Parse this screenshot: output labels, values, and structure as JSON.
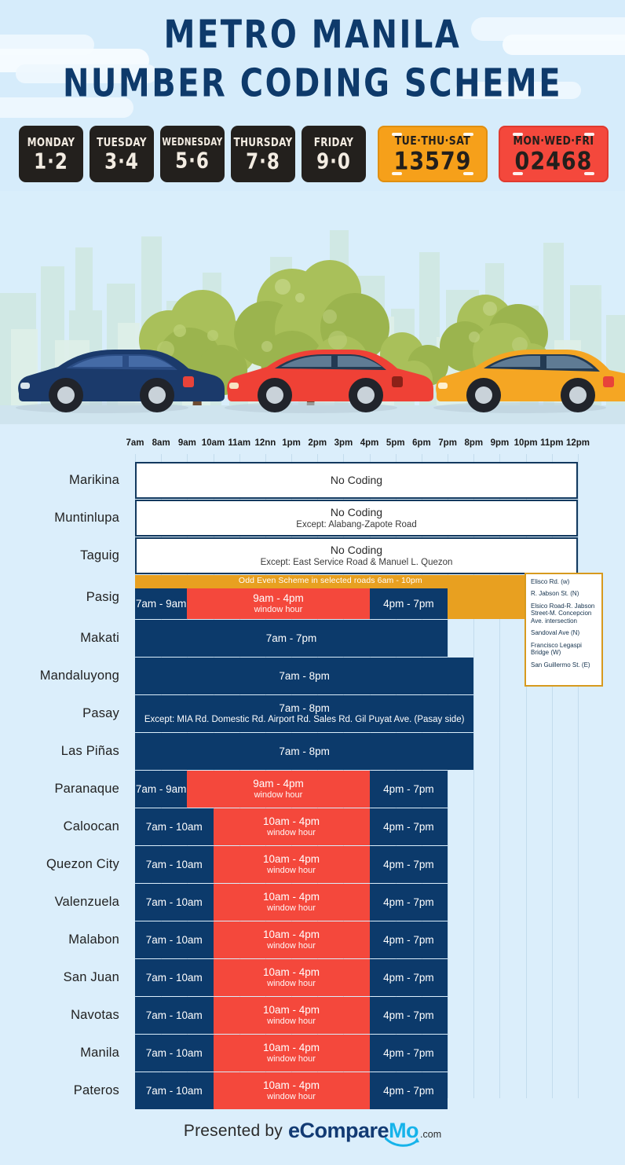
{
  "title": {
    "line1": "METRO MANILA",
    "line2": "NUMBER CODING SCHEME"
  },
  "colors": {
    "background": "#d9eefb",
    "title_navy": "#0e3a6b",
    "bar_navy": "#0c3a6b",
    "bar_red": "#f4483c",
    "odd_even_orange": "#e8a020",
    "plate_odd": "#f6a01a",
    "plate_even": "#f4483c",
    "badge_dark": "#23201d"
  },
  "day_badges": [
    {
      "day": "MONDAY",
      "numbers": "1·2"
    },
    {
      "day": "TUESDAY",
      "numbers": "3·4"
    },
    {
      "day": "WEDNESDAY",
      "numbers": "5·6"
    },
    {
      "day": "THURSDAY",
      "numbers": "7·8"
    },
    {
      "day": "FRIDAY",
      "numbers": "9·0"
    }
  ],
  "plates": [
    {
      "days": "TUE·THU·SAT",
      "number": "13579",
      "type": "odd"
    },
    {
      "days": "MON·WED·FRI",
      "number": "02468",
      "type": "even"
    }
  ],
  "illustration": {
    "cars": [
      "navy-car",
      "red-car",
      "yellow-car"
    ],
    "scene": "city-skyline-with-trees"
  },
  "chart_data": {
    "type": "bar",
    "title": "Metro Manila Number Coding Scheme",
    "xlabel": "",
    "ylabel": "",
    "orientation": "horizontal",
    "x_axis_ticks": [
      "7am",
      "8am",
      "9am",
      "10am",
      "11am",
      "12nn",
      "1pm",
      "2pm",
      "3pm",
      "4pm",
      "5pm",
      "6pm",
      "7pm",
      "8pm",
      "9pm",
      "10pm",
      "11pm",
      "12pm"
    ],
    "x_axis_hours": [
      7,
      8,
      9,
      10,
      11,
      12,
      13,
      14,
      15,
      16,
      17,
      18,
      19,
      20,
      21,
      22,
      23,
      24
    ],
    "xlim": [
      7,
      24
    ],
    "grid": true,
    "legend": null,
    "categories": [
      "Marikina",
      "Muntinlupa",
      "Taguig",
      "Pasig",
      "Makati",
      "Mandaluyong",
      "Pasay",
      "Las Piñas",
      "Paranaque",
      "Caloocan",
      "Quezon City",
      "Valenzuela",
      "Malabon",
      "San Juan",
      "Navotas",
      "Manila",
      "Pateros"
    ],
    "rows": [
      {
        "city": "Marikina",
        "kind": "no-coding",
        "label": "No Coding",
        "note": "",
        "span": [
          7,
          24
        ]
      },
      {
        "city": "Muntinlupa",
        "kind": "no-coding",
        "label": "No Coding",
        "note": "Except: Alabang-Zapote Road",
        "span": [
          7,
          24
        ]
      },
      {
        "city": "Taguig",
        "kind": "no-coding",
        "label": "No Coding",
        "note": "Except: East Service Road & Manuel L. Quezon",
        "span": [
          7,
          24
        ]
      },
      {
        "city": "Pasig",
        "kind": "window",
        "odd_even_label": "Odd Even Scheme in selected roads 6am - 10pm",
        "odd_even_span": [
          7,
          22
        ],
        "segments": [
          {
            "type": "navy",
            "label": "7am - 9am",
            "sub": "",
            "span": [
              7,
              9
            ]
          },
          {
            "type": "red",
            "label": "9am - 4pm",
            "sub": "window hour",
            "span": [
              9,
              16
            ]
          },
          {
            "type": "navy",
            "label": "4pm - 7pm",
            "sub": "",
            "span": [
              16,
              19
            ]
          }
        ],
        "notes": [
          "Elisco Rd. (w)",
          "R. Jabson St. (N)",
          "Elsico Road-R. Jabson Street-M. Concepcion Ave. intersection",
          "Sandoval Ave (N)",
          "Francisco Legaspi Bridge (W)",
          "San Guillermo St. (E)"
        ]
      },
      {
        "city": "Makati",
        "kind": "solid",
        "label": "7am - 7pm",
        "note": "",
        "span": [
          7,
          19
        ]
      },
      {
        "city": "Mandaluyong",
        "kind": "solid",
        "label": "7am - 8pm",
        "note": "",
        "span": [
          7,
          20
        ]
      },
      {
        "city": "Pasay",
        "kind": "solid",
        "label": "7am - 8pm",
        "note": "Except: MIA Rd. Domestic Rd. Airport Rd. Sales Rd. Gil Puyat Ave. (Pasay side)",
        "span": [
          7,
          20
        ]
      },
      {
        "city": "Las Piñas",
        "kind": "solid",
        "label": "7am - 8pm",
        "note": "",
        "span": [
          7,
          20
        ]
      },
      {
        "city": "Paranaque",
        "kind": "window",
        "segments": [
          {
            "type": "navy",
            "label": "7am - 9am",
            "sub": "",
            "span": [
              7,
              9
            ]
          },
          {
            "type": "red",
            "label": "9am - 4pm",
            "sub": "window hour",
            "span": [
              9,
              16
            ]
          },
          {
            "type": "navy",
            "label": "4pm - 7pm",
            "sub": "",
            "span": [
              16,
              19
            ]
          }
        ]
      },
      {
        "city": "Caloocan",
        "kind": "window",
        "segments": [
          {
            "type": "navy",
            "label": "7am - 10am",
            "sub": "",
            "span": [
              7,
              10
            ]
          },
          {
            "type": "red",
            "label": "10am - 4pm",
            "sub": "window hour",
            "span": [
              10,
              16
            ]
          },
          {
            "type": "navy",
            "label": "4pm - 7pm",
            "sub": "",
            "span": [
              16,
              19
            ]
          }
        ]
      },
      {
        "city": "Quezon City",
        "kind": "window",
        "segments": [
          {
            "type": "navy",
            "label": "7am - 10am",
            "sub": "",
            "span": [
              7,
              10
            ]
          },
          {
            "type": "red",
            "label": "10am - 4pm",
            "sub": "window hour",
            "span": [
              10,
              16
            ]
          },
          {
            "type": "navy",
            "label": "4pm - 7pm",
            "sub": "",
            "span": [
              16,
              19
            ]
          }
        ]
      },
      {
        "city": "Valenzuela",
        "kind": "window",
        "segments": [
          {
            "type": "navy",
            "label": "7am - 10am",
            "sub": "",
            "span": [
              7,
              10
            ]
          },
          {
            "type": "red",
            "label": "10am - 4pm",
            "sub": "window hour",
            "span": [
              10,
              16
            ]
          },
          {
            "type": "navy",
            "label": "4pm - 7pm",
            "sub": "",
            "span": [
              16,
              19
            ]
          }
        ]
      },
      {
        "city": "Malabon",
        "kind": "window",
        "segments": [
          {
            "type": "navy",
            "label": "7am - 10am",
            "sub": "",
            "span": [
              7,
              10
            ]
          },
          {
            "type": "red",
            "label": "10am - 4pm",
            "sub": "window hour",
            "span": [
              10,
              16
            ]
          },
          {
            "type": "navy",
            "label": "4pm - 7pm",
            "sub": "",
            "span": [
              16,
              19
            ]
          }
        ]
      },
      {
        "city": "San Juan",
        "kind": "window",
        "segments": [
          {
            "type": "navy",
            "label": "7am - 10am",
            "sub": "",
            "span": [
              7,
              10
            ]
          },
          {
            "type": "red",
            "label": "10am - 4pm",
            "sub": "window hour",
            "span": [
              10,
              16
            ]
          },
          {
            "type": "navy",
            "label": "4pm - 7pm",
            "sub": "",
            "span": [
              16,
              19
            ]
          }
        ]
      },
      {
        "city": "Navotas",
        "kind": "window",
        "segments": [
          {
            "type": "navy",
            "label": "7am - 10am",
            "sub": "",
            "span": [
              7,
              10
            ]
          },
          {
            "type": "red",
            "label": "10am - 4pm",
            "sub": "window hour",
            "span": [
              10,
              16
            ]
          },
          {
            "type": "navy",
            "label": "4pm - 7pm",
            "sub": "",
            "span": [
              16,
              19
            ]
          }
        ]
      },
      {
        "city": "Manila",
        "kind": "window",
        "segments": [
          {
            "type": "navy",
            "label": "7am - 10am",
            "sub": "",
            "span": [
              7,
              10
            ]
          },
          {
            "type": "red",
            "label": "10am - 4pm",
            "sub": "window hour",
            "span": [
              10,
              16
            ]
          },
          {
            "type": "navy",
            "label": "4pm - 7pm",
            "sub": "",
            "span": [
              16,
              19
            ]
          }
        ]
      },
      {
        "city": "Pateros",
        "kind": "window",
        "segments": [
          {
            "type": "navy",
            "label": "7am - 10am",
            "sub": "",
            "span": [
              7,
              10
            ]
          },
          {
            "type": "red",
            "label": "10am - 4pm",
            "sub": "window hour",
            "span": [
              10,
              16
            ]
          },
          {
            "type": "navy",
            "label": "4pm - 7pm",
            "sub": "",
            "span": [
              16,
              19
            ]
          }
        ]
      }
    ]
  },
  "footer": {
    "presented_by": "Presented by",
    "brand_part1": "eCompare",
    "brand_part2": "Mo",
    "brand_tld": ".com"
  }
}
